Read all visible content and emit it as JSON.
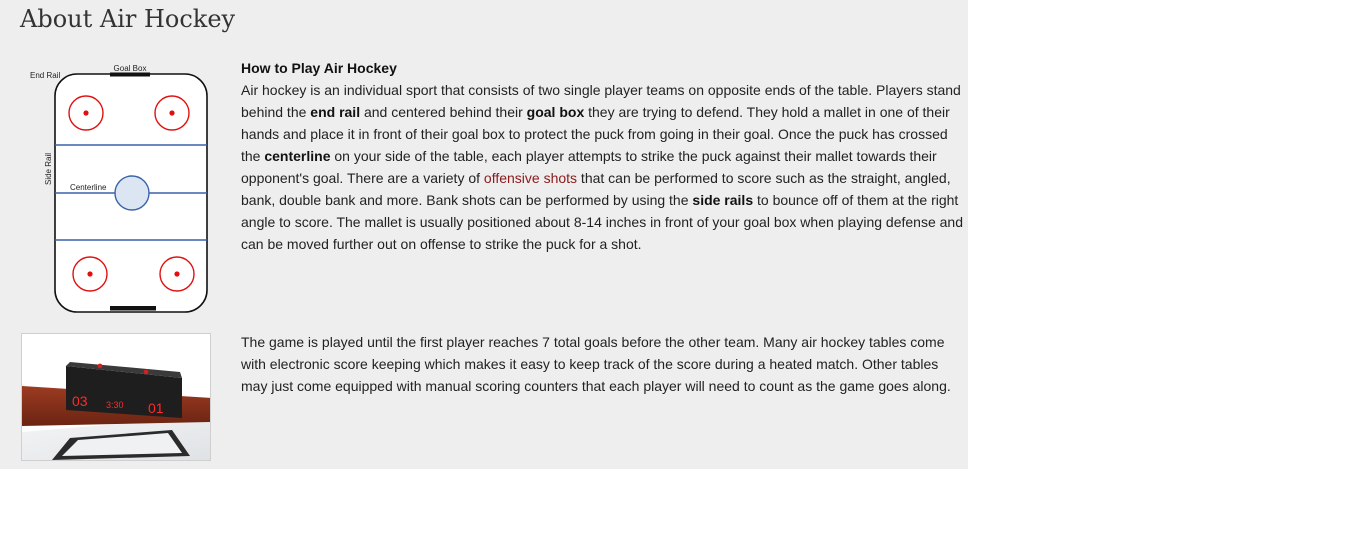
{
  "page": {
    "title": "About Air Hockey"
  },
  "diagram": {
    "labels": {
      "goal_box": "Goal Box",
      "end_rail": "End Rail",
      "side_rail": "Side Rail",
      "centerline": "Centerline"
    },
    "colors": {
      "rink_border": "#111111",
      "blue_lines": "#3a62a8",
      "faceoff": "#e01010",
      "puck_fill": "#dce6f3",
      "puck_stroke": "#3a62a8"
    }
  },
  "section1": {
    "heading": "How to Play Air Hockey",
    "paragraph": [
      {
        "text": "Air hockey is an individual sport that consists of two single player teams on opposite ends of the table. Players stand behind the "
      },
      {
        "text": "end rail",
        "style": "bold"
      },
      {
        "text": " and centered behind their "
      },
      {
        "text": "goal box",
        "style": "bold"
      },
      {
        "text": " they are trying to defend. They hold a mallet in one of their hands and place it in front of their goal box to protect the puck from going in their goal. Once the puck has crossed the "
      },
      {
        "text": "centerline",
        "style": "bold"
      },
      {
        "text": " on your side of the table, each player attempts to strike the puck against their mallet towards their opponent's goal. There are a variety of "
      },
      {
        "text": "offensive shots",
        "style": "link"
      },
      {
        "text": " that can be performed to score such as the straight, angled, bank, double bank and more. Bank shots can be performed by using the "
      },
      {
        "text": "side rails",
        "style": "bold"
      },
      {
        "text": " to bounce off of them at the right angle to score. The mallet is usually positioned about 8-14 inches in front of your goal box when playing defense and can be moved further out on offense to strike the puck for a shot."
      }
    ]
  },
  "section2": {
    "paragraph": "The game is played until the first player reaches 7 total goals before the other team. Many air hockey tables come with electronic score keeping which makes it easy to keep track of the score during a heated match. Other tables may just come equipped with manual scoring counters that each player will need to count as the game goes along."
  },
  "scoreboard": {
    "left_score": "03",
    "clock": "3:30",
    "right_score": "01"
  }
}
